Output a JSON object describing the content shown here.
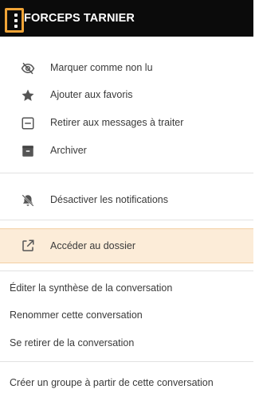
{
  "header": {
    "title": "FORCEPS TARNIER"
  },
  "menu": {
    "mark_unread": {
      "label": "Marquer comme non lu",
      "icon": "eye-off-icon"
    },
    "favorite": {
      "label": "Ajouter aux favoris",
      "icon": "star-icon"
    },
    "remove_todo": {
      "label": "Retirer aux messages à traiter",
      "icon": "minus-box-icon"
    },
    "archive": {
      "label": "Archiver",
      "icon": "archive-icon"
    },
    "mute": {
      "label": "Désactiver les notifications",
      "icon": "bell-off-icon"
    },
    "open_folder": {
      "label": "Accéder au dossier",
      "icon": "open-in-new-icon"
    },
    "edit_summary": {
      "label": "Éditer la synthèse de la conversation"
    },
    "rename": {
      "label": "Renommer cette conversation"
    },
    "leave": {
      "label": "Se retirer de la conversation"
    },
    "create_group": {
      "label": "Créer un groupe à partir de cette conversation"
    }
  },
  "colors": {
    "header_bg": "#0b0b0b",
    "accent_orange": "#f0a437",
    "highlight_bg": "#fcecd8",
    "icon_gray": "#555555"
  }
}
